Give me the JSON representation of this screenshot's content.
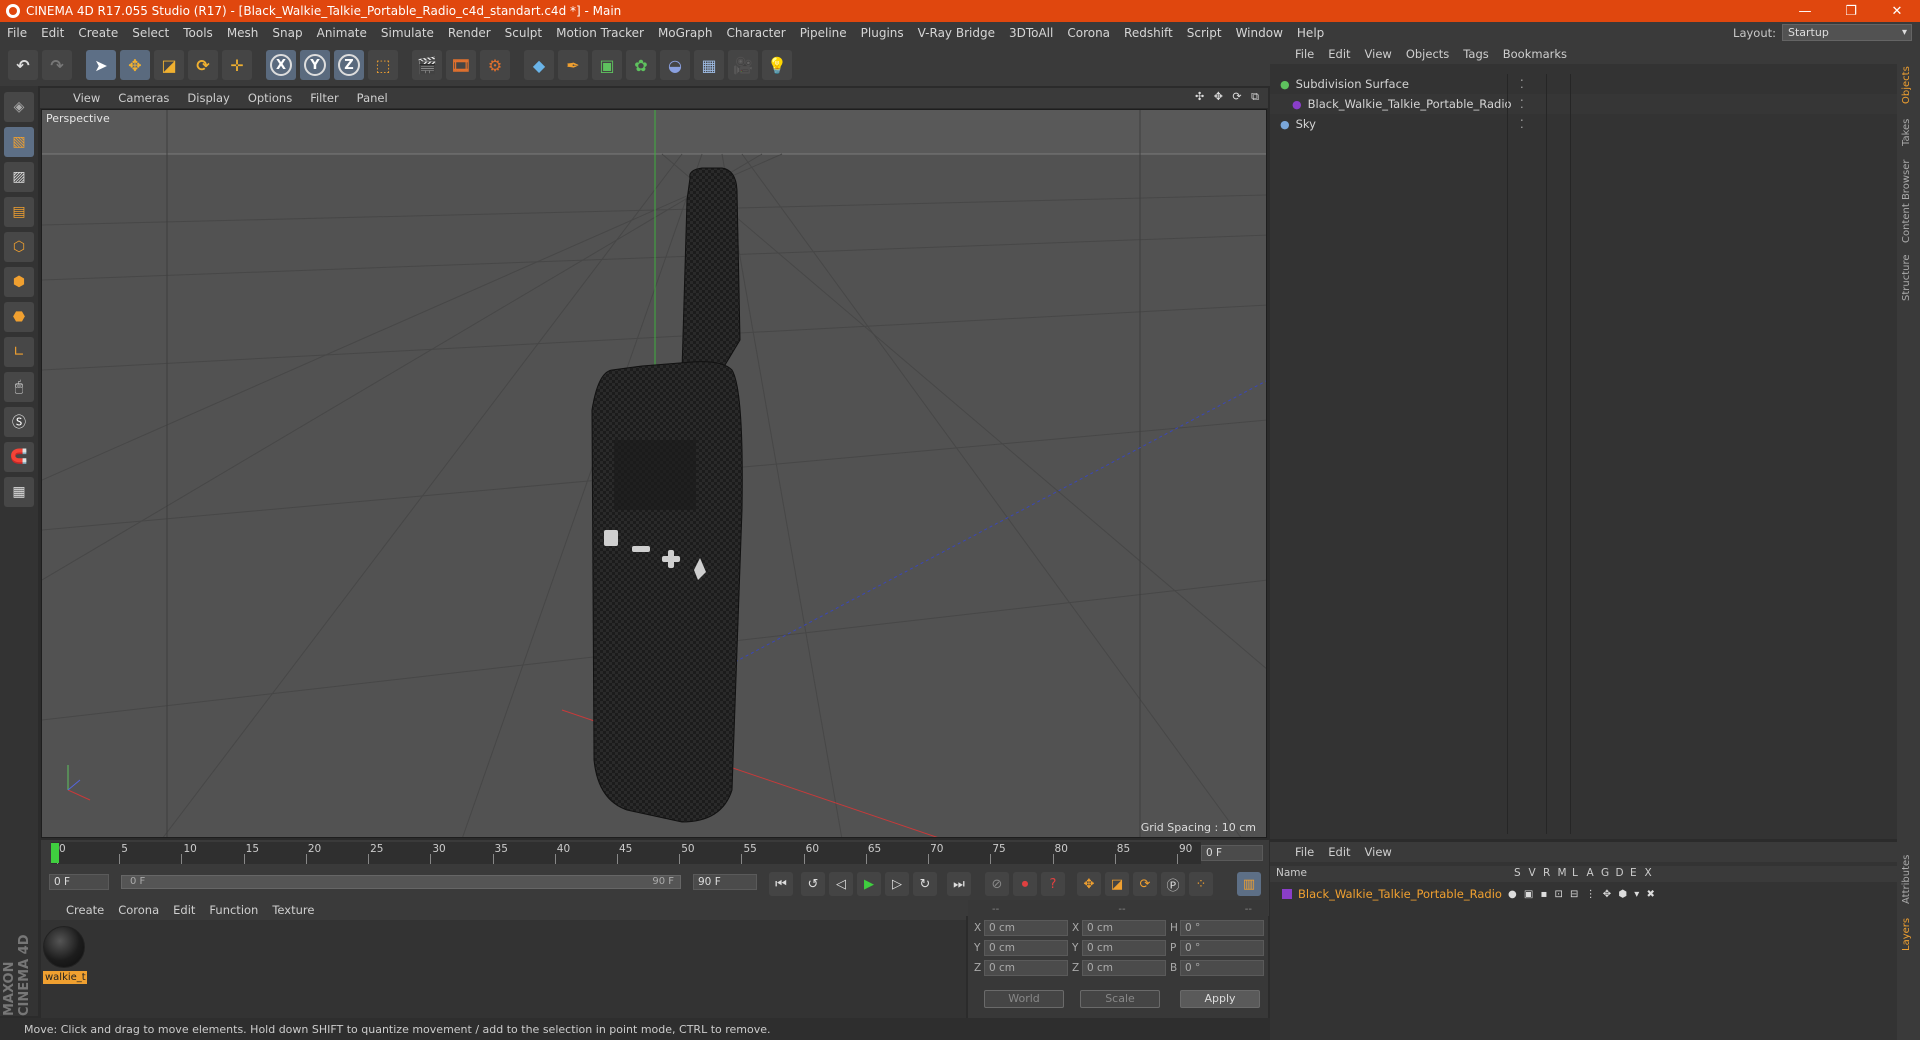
{
  "window": {
    "title": "CINEMA 4D R17.055 Studio (R17) - [Black_Walkie_Talkie_Portable_Radio_c4d_standart.c4d *] - Main",
    "controls": [
      "—",
      "❐",
      "✕"
    ]
  },
  "menu": [
    "File",
    "Edit",
    "Create",
    "Select",
    "Tools",
    "Mesh",
    "Snap",
    "Animate",
    "Simulate",
    "Render",
    "Sculpt",
    "Motion Tracker",
    "MoGraph",
    "Character",
    "Pipeline",
    "Plugins",
    "V-Ray Bridge",
    "3DToAll",
    "Corona",
    "Redshift",
    "Script",
    "Window",
    "Help"
  ],
  "layout": {
    "label": "Layout:",
    "value": "Startup"
  },
  "toolbar": {
    "icons": [
      "undo-icon",
      "redo-icon",
      "select-arrow-icon",
      "move-icon",
      "scale-icon",
      "rotate-icon",
      "move-plus-icon",
      "x-axis-icon",
      "y-axis-icon",
      "z-axis-icon",
      "world-coords-icon",
      "render-view-icon",
      "render-picture-queue-icon",
      "render-settings-icon",
      "cube-icon",
      "pen-spline-icon",
      "subdivision-icon",
      "array-icon",
      "deformer-icon",
      "floor-grid-icon",
      "camera-icon",
      "light-icon"
    ],
    "axis_labels": [
      "X",
      "Y",
      "Z"
    ]
  },
  "left_tools": [
    "model-mode-icon",
    "texture-mode-icon",
    "workplane-icon",
    "points-mode-icon",
    "edges-mode-icon",
    "polygons-mode-icon",
    "axis-mode-icon",
    "tweak-mode-icon",
    "solo-icon",
    "magnet-icon",
    "snap-grid-icon",
    "snap-lock-icon"
  ],
  "viewport": {
    "menu": [
      "View",
      "Cameras",
      "Display",
      "Options",
      "Filter",
      "Panel"
    ],
    "label": "Perspective",
    "grid_spacing": "Grid Spacing : 10 cm",
    "nav_icons": "✣ ✥ ⟳ ⧉"
  },
  "object_manager": {
    "menu": [
      "File",
      "Edit",
      "View",
      "Objects",
      "Tags",
      "Bookmarks"
    ],
    "objects": [
      {
        "name": "Subdivision Surface",
        "indent": 0,
        "color": "#5ec25e"
      },
      {
        "name": "Black_Walkie_Talkie_Portable_Radio",
        "indent": 1,
        "color": "#8a3ec8"
      },
      {
        "name": "Sky",
        "indent": 0,
        "color": "#7aa6d8"
      }
    ]
  },
  "right_tabs": [
    "Objects",
    "Takes",
    "Content Browser",
    "Structure",
    "Attributes",
    "Layers"
  ],
  "timeline": {
    "ticks": [
      "0",
      "5",
      "10",
      "15",
      "20",
      "25",
      "30",
      "35",
      "40",
      "45",
      "50",
      "55",
      "60",
      "65",
      "70",
      "75",
      "80",
      "85",
      "90"
    ],
    "current_frame_right": "0 F",
    "start_field": "0 F",
    "range_start": "0 F",
    "range_end": "90 F",
    "end_field": "90 F"
  },
  "materials": {
    "menu": [
      "Create",
      "Corona",
      "Edit",
      "Function",
      "Texture"
    ],
    "items": [
      {
        "name": "walkie_t"
      }
    ]
  },
  "coordinates": {
    "headers": [
      "--",
      "--",
      "--"
    ],
    "rows": [
      {
        "a": "X",
        "av": "0 cm",
        "b": "X",
        "bv": "0 cm",
        "c": "H",
        "cv": "0 °"
      },
      {
        "a": "Y",
        "av": "0 cm",
        "b": "Y",
        "bv": "0 cm",
        "c": "P",
        "cv": "0 °"
      },
      {
        "a": "Z",
        "av": "0 cm",
        "b": "Z",
        "bv": "0 cm",
        "c": "B",
        "cv": "0 °"
      }
    ],
    "world_select": "World",
    "scale_select": "Scale",
    "apply": "Apply"
  },
  "layers": {
    "menu": [
      "File",
      "Edit",
      "View"
    ],
    "columns": [
      "Name",
      "S",
      "V",
      "R",
      "M",
      "L",
      "A",
      "G",
      "D",
      "E",
      "X"
    ],
    "rows": [
      {
        "name": "Black_Walkie_Talkie_Portable_Radio",
        "color": "#8a3ec8"
      }
    ]
  },
  "status": "Move: Click and drag to move elements. Hold down SHIFT to quantize movement / add to the selection in point mode, CTRL to remove.",
  "brand": "MAXON CINEMA 4D",
  "colors": {
    "accent": "#e0470e",
    "highlight": "#f0a030",
    "selected_tool": "#5a6a7e"
  }
}
